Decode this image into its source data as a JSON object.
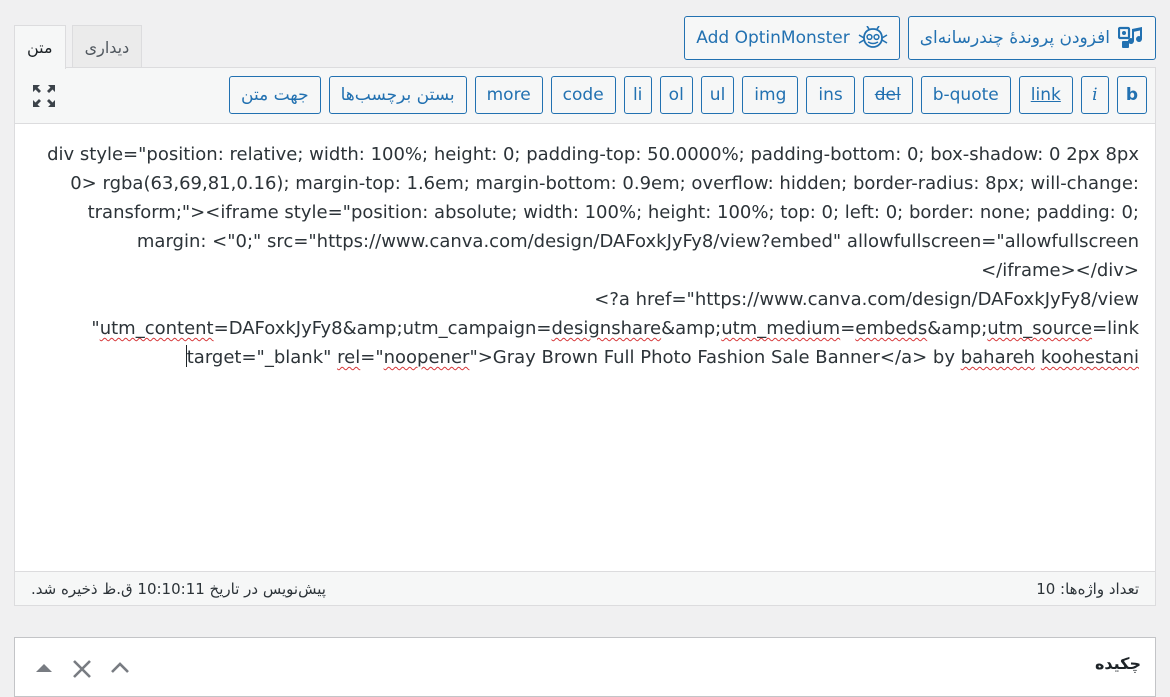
{
  "media_buttons": {
    "add_media_label": "افزودن پروندهٔ چندرسانه‌ای",
    "optinmonster_label": "Add OptinMonster"
  },
  "editor_tabs": {
    "text_label": "متن",
    "visual_label": "دیداری"
  },
  "quicktags": [
    {
      "label": "b",
      "style": "bold"
    },
    {
      "label": "i",
      "style": "ital"
    },
    {
      "label": "link",
      "style": "under"
    },
    {
      "label": "b-quote",
      "style": ""
    },
    {
      "label": "del",
      "style": "strike"
    },
    {
      "label": "ins",
      "style": ""
    },
    {
      "label": "img",
      "style": ""
    },
    {
      "label": "ul",
      "style": ""
    },
    {
      "label": "ol",
      "style": ""
    },
    {
      "label": "li",
      "style": ""
    },
    {
      "label": "code",
      "style": ""
    },
    {
      "label": "more",
      "style": ""
    },
    {
      "label": "بستن برچسب‌ها",
      "style": ""
    },
    {
      "label": "جهت متن",
      "style": ""
    }
  ],
  "content": {
    "line1": "div style=\"position: relative; width: 100%; height: 0; padding-top: 50.0000%; padding-bottom: 0; box-shadow: 0 2px 8px 0> rgba(63,69,81,0.16); margin-top: 1.6em; margin-bottom: 0.9em; overflow: hidden; border-radius: 8px; will-change: transform;\"><iframe style=\"position: absolute; width: 100%; height: 100%; top: 0; left: 0; border: none; padding: 0; margin: <\"0;\" src=\"https://www.canva.com/design/DAFoxkJyFy8/view?embed\" allowfullscreen=\"allowfullscreen",
    "line2": "<iframe></div/>",
    "line3": "a href=\"https://www.canva.com/design/DAFoxkJyFy8/view?>",
    "line4_a": "utm_content",
    "line4_b": "=DAFoxkJyFy8&amp;utm_campaign=",
    "line4_c": "designshare",
    "line4_d": "&amp;",
    "line4_e": "utm_medium",
    "line4_f": "=",
    "line4_g": "embeds",
    "line4_h": "&amp;",
    "line4_i": "utm_source",
    "line4_j": "=link\"",
    "line5_a": "target=\"_blank\" ",
    "line5_b": "rel",
    "line5_c": "=\"",
    "line5_d": "noopener",
    "line5_e": "\">Gray Brown Full Photo Fashion Sale Banner</a> by ",
    "line5_f": "bahareh",
    "line5_g": " ",
    "line5_h": "koohestani"
  },
  "status": {
    "word_count": "تعداد واژه‌ها: 10",
    "autosave": "پیش‌نویس در تاریخ 10:10:11 ق.ظ ذخیره شد."
  },
  "excerpt": {
    "title": "چکیده"
  },
  "colors": {
    "accent": "#2271b1",
    "background": "#f0f0f1",
    "spell_error": "#d63638"
  }
}
